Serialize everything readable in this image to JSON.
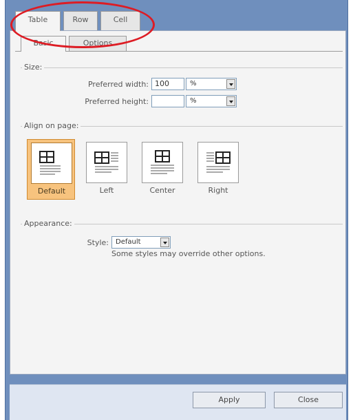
{
  "tabs": [
    {
      "label": "Table",
      "active": true
    },
    {
      "label": "Row",
      "active": false
    },
    {
      "label": "Cell",
      "active": false
    }
  ],
  "subtabs": [
    {
      "label": "Basic",
      "active": true
    },
    {
      "label": "Options",
      "active": false
    }
  ],
  "size": {
    "group_label": "Size:",
    "preferred_width_label": "Preferred width:",
    "preferred_width_value": "100",
    "preferred_width_unit": "%",
    "preferred_height_label": "Preferred height:",
    "preferred_height_value": "",
    "preferred_height_unit": "%"
  },
  "align": {
    "group_label": "Align on page:",
    "options": [
      {
        "label": "Default",
        "icon": "table-align-default-icon",
        "selected": true
      },
      {
        "label": "Left",
        "icon": "table-align-left-icon",
        "selected": false
      },
      {
        "label": "Center",
        "icon": "table-align-center-icon",
        "selected": false
      },
      {
        "label": "Right",
        "icon": "table-align-right-icon",
        "selected": false
      }
    ]
  },
  "appearance": {
    "group_label": "Appearance:",
    "style_label": "Style:",
    "style_value": "Default",
    "note": "Some styles may override other options."
  },
  "buttons": {
    "apply": "Apply",
    "close": "Close"
  },
  "colors": {
    "frame": "#6f8fbd",
    "selected_option": "#f7c37e",
    "highlight_ellipse": "#dd1c24"
  }
}
